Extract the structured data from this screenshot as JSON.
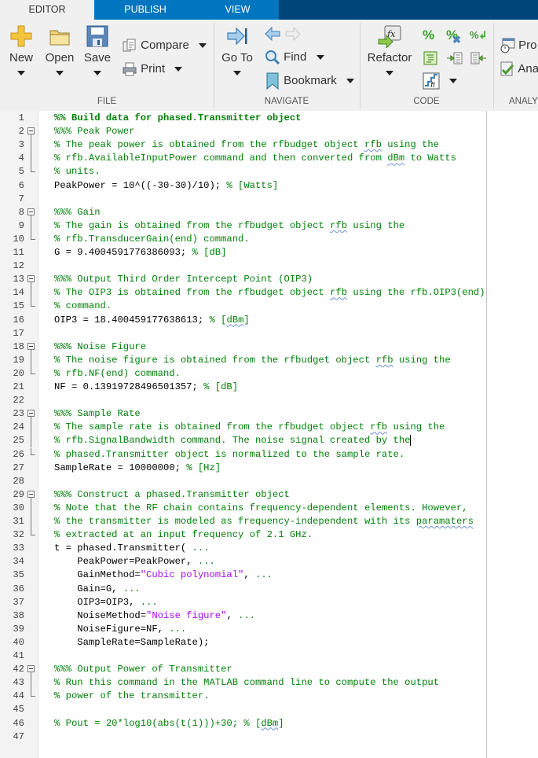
{
  "tabs": [
    {
      "label": "EDITOR",
      "active": true
    },
    {
      "label": "PUBLISH",
      "active": false
    },
    {
      "label": "VIEW",
      "active": false
    }
  ],
  "ribbon": {
    "file": {
      "section_label": "FILE",
      "new_label": "New",
      "open_label": "Open",
      "save_label": "Save",
      "compare_label": "Compare",
      "print_label": "Print"
    },
    "navigate": {
      "section_label": "NAVIGATE",
      "goto_label": "Go To",
      "find_label": "Find",
      "bookmark_label": "Bookmark"
    },
    "code": {
      "section_label": "CODE",
      "refactor_label": "Refactor"
    },
    "analyze": {
      "section_label": "ANALY",
      "profiler_label": "Pro",
      "analyze_label": "Ana"
    }
  },
  "colors": {
    "tab_active_bg": "#f0f0f0",
    "tab_blue": "#0076c0",
    "tab_dark": "#00457a",
    "comment": "#028009",
    "string": "#a709f5"
  },
  "editor": {
    "lines": [
      {
        "n": "1",
        "fold": "",
        "segs": [
          {
            "t": "%% Build data for phased.Transmitter object",
            "c": "c-section"
          }
        ]
      },
      {
        "n": "2",
        "fold": "start",
        "segs": [
          {
            "t": "%%% Peak Power",
            "c": "c-comment"
          }
        ]
      },
      {
        "n": "3",
        "fold": "mid",
        "segs": [
          {
            "t": "% The peak power is obtained from the rfbudget object ",
            "c": "c-comment"
          },
          {
            "t": "rfb",
            "c": "c-comment squiggle"
          },
          {
            "t": " using the",
            "c": "c-comment"
          }
        ]
      },
      {
        "n": "4",
        "fold": "mid",
        "segs": [
          {
            "t": "% rfb.AvailableInputPower command and then converted from ",
            "c": "c-comment"
          },
          {
            "t": "dBm",
            "c": "c-comment squiggle"
          },
          {
            "t": " to Watts",
            "c": "c-comment"
          }
        ]
      },
      {
        "n": "5",
        "fold": "end",
        "segs": [
          {
            "t": "% units.",
            "c": "c-comment"
          }
        ]
      },
      {
        "n": "6",
        "fold": "",
        "segs": [
          {
            "t": "PeakPower = 10^((-30-30)/10); ",
            "c": ""
          },
          {
            "t": "% [Watts]",
            "c": "c-comment"
          }
        ]
      },
      {
        "n": "7",
        "fold": "",
        "segs": []
      },
      {
        "n": "8",
        "fold": "start",
        "segs": [
          {
            "t": "%%% Gain",
            "c": "c-comment"
          }
        ]
      },
      {
        "n": "9",
        "fold": "mid",
        "segs": [
          {
            "t": "% The gain is obtained from the rfbudget object ",
            "c": "c-comment"
          },
          {
            "t": "rfb",
            "c": "c-comment squiggle"
          },
          {
            "t": " using the",
            "c": "c-comment"
          }
        ]
      },
      {
        "n": "10",
        "fold": "end",
        "segs": [
          {
            "t": "% rfb.TransducerGain(end) command.",
            "c": "c-comment"
          }
        ]
      },
      {
        "n": "11",
        "fold": "",
        "segs": [
          {
            "t": "G = 9.4004591776386093; ",
            "c": ""
          },
          {
            "t": "% [dB]",
            "c": "c-comment"
          }
        ]
      },
      {
        "n": "12",
        "fold": "",
        "segs": []
      },
      {
        "n": "13",
        "fold": "start",
        "segs": [
          {
            "t": "%%% Output Third Order Intercept Point (OIP3)",
            "c": "c-comment"
          }
        ]
      },
      {
        "n": "14",
        "fold": "mid",
        "segs": [
          {
            "t": "% The OIP3 is obtained from the rfbudget object ",
            "c": "c-comment"
          },
          {
            "t": "rfb",
            "c": "c-comment squiggle"
          },
          {
            "t": " using the rfb.OIP3(end)",
            "c": "c-comment"
          }
        ]
      },
      {
        "n": "15",
        "fold": "end",
        "segs": [
          {
            "t": "% command.",
            "c": "c-comment"
          }
        ]
      },
      {
        "n": "16",
        "fold": "",
        "segs": [
          {
            "t": "OIP3 = 18.400459177638613; ",
            "c": ""
          },
          {
            "t": "% [",
            "c": "c-comment"
          },
          {
            "t": "dBm",
            "c": "c-comment squiggle"
          },
          {
            "t": "]",
            "c": "c-comment"
          }
        ]
      },
      {
        "n": "17",
        "fold": "",
        "segs": []
      },
      {
        "n": "18",
        "fold": "start",
        "segs": [
          {
            "t": "%%% Noise Figure",
            "c": "c-comment"
          }
        ]
      },
      {
        "n": "19",
        "fold": "mid",
        "segs": [
          {
            "t": "% The noise figure is obtained from the rfbudget object ",
            "c": "c-comment"
          },
          {
            "t": "rfb",
            "c": "c-comment squiggle"
          },
          {
            "t": " using the",
            "c": "c-comment"
          }
        ]
      },
      {
        "n": "20",
        "fold": "end",
        "segs": [
          {
            "t": "% rfb.NF(end) command.",
            "c": "c-comment"
          }
        ]
      },
      {
        "n": "21",
        "fold": "",
        "segs": [
          {
            "t": "NF = 0.13919728496501357; ",
            "c": ""
          },
          {
            "t": "% [dB]",
            "c": "c-comment"
          }
        ]
      },
      {
        "n": "22",
        "fold": "",
        "segs": []
      },
      {
        "n": "23",
        "fold": "start",
        "segs": [
          {
            "t": "%%% Sample Rate",
            "c": "c-comment"
          }
        ]
      },
      {
        "n": "24",
        "fold": "mid",
        "segs": [
          {
            "t": "% The sample rate is obtained from the rfbudget object ",
            "c": "c-comment"
          },
          {
            "t": "rfb",
            "c": "c-comment squiggle"
          },
          {
            "t": " using the",
            "c": "c-comment"
          }
        ]
      },
      {
        "n": "25",
        "fold": "mid",
        "cursor": true,
        "segs": [
          {
            "t": "% rfb.SignalBandwidth command. The noise signal created by the",
            "c": "c-comment"
          }
        ]
      },
      {
        "n": "26",
        "fold": "end",
        "segs": [
          {
            "t": "% phased.Transmitter object is normalized to the sample rate.",
            "c": "c-comment"
          }
        ]
      },
      {
        "n": "27",
        "fold": "",
        "segs": [
          {
            "t": "SampleRate = 10000000; ",
            "c": ""
          },
          {
            "t": "% [Hz]",
            "c": "c-comment"
          }
        ]
      },
      {
        "n": "28",
        "fold": "",
        "segs": []
      },
      {
        "n": "29",
        "fold": "start",
        "segs": [
          {
            "t": "%%% Construct a phased.Transmitter object",
            "c": "c-comment"
          }
        ]
      },
      {
        "n": "30",
        "fold": "mid",
        "segs": [
          {
            "t": "% Note that the RF chain contains frequency-dependent elements. However,",
            "c": "c-comment"
          }
        ]
      },
      {
        "n": "31",
        "fold": "mid",
        "segs": [
          {
            "t": "% the transmitter is modeled as frequency-independent with its ",
            "c": "c-comment"
          },
          {
            "t": "paramaters",
            "c": "c-comment squiggle"
          }
        ]
      },
      {
        "n": "32",
        "fold": "end",
        "segs": [
          {
            "t": "% extracted at an input frequency of 2.1 GHz.",
            "c": "c-comment"
          }
        ]
      },
      {
        "n": "33",
        "fold": "",
        "segs": [
          {
            "t": "t = phased.Transmitter( ",
            "c": ""
          },
          {
            "t": "...",
            "c": "c-comment"
          }
        ]
      },
      {
        "n": "34",
        "fold": "",
        "segs": [
          {
            "t": "    PeakPower=PeakPower, ",
            "c": ""
          },
          {
            "t": "...",
            "c": "c-comment"
          }
        ]
      },
      {
        "n": "35",
        "fold": "",
        "segs": [
          {
            "t": "    GainMethod=",
            "c": ""
          },
          {
            "t": "\"Cubic polynomial\"",
            "c": "c-string"
          },
          {
            "t": ", ",
            "c": ""
          },
          {
            "t": "...",
            "c": "c-comment"
          }
        ]
      },
      {
        "n": "36",
        "fold": "",
        "segs": [
          {
            "t": "    Gain=G, ",
            "c": ""
          },
          {
            "t": "...",
            "c": "c-comment"
          }
        ]
      },
      {
        "n": "37",
        "fold": "",
        "segs": [
          {
            "t": "    OIP3=OIP3, ",
            "c": ""
          },
          {
            "t": "...",
            "c": "c-comment"
          }
        ]
      },
      {
        "n": "38",
        "fold": "",
        "segs": [
          {
            "t": "    NoiseMethod=",
            "c": ""
          },
          {
            "t": "\"Noise figure\"",
            "c": "c-string"
          },
          {
            "t": ", ",
            "c": ""
          },
          {
            "t": "...",
            "c": "c-comment"
          }
        ]
      },
      {
        "n": "39",
        "fold": "",
        "segs": [
          {
            "t": "    NoiseFigure=NF, ",
            "c": ""
          },
          {
            "t": "...",
            "c": "c-comment"
          }
        ]
      },
      {
        "n": "40",
        "fold": "",
        "segs": [
          {
            "t": "    SampleRate=SampleRate);",
            "c": ""
          }
        ]
      },
      {
        "n": "41",
        "fold": "",
        "segs": []
      },
      {
        "n": "42",
        "fold": "start",
        "segs": [
          {
            "t": "%%% Output Power of Transmitter",
            "c": "c-comment"
          }
        ]
      },
      {
        "n": "43",
        "fold": "mid",
        "segs": [
          {
            "t": "% Run this command in the MATLAB command line to compute the output",
            "c": "c-comment"
          }
        ]
      },
      {
        "n": "44",
        "fold": "end",
        "segs": [
          {
            "t": "% power of the transmitter.",
            "c": "c-comment"
          }
        ]
      },
      {
        "n": "45",
        "fold": "",
        "segs": []
      },
      {
        "n": "46",
        "fold": "",
        "segs": [
          {
            "t": "% Pout = 20*log10(abs(t(1)))+30; % [",
            "c": "c-comment"
          },
          {
            "t": "dBm",
            "c": "c-comment squiggle"
          },
          {
            "t": "]",
            "c": "c-comment"
          }
        ]
      },
      {
        "n": "47",
        "fold": "",
        "segs": []
      }
    ]
  }
}
